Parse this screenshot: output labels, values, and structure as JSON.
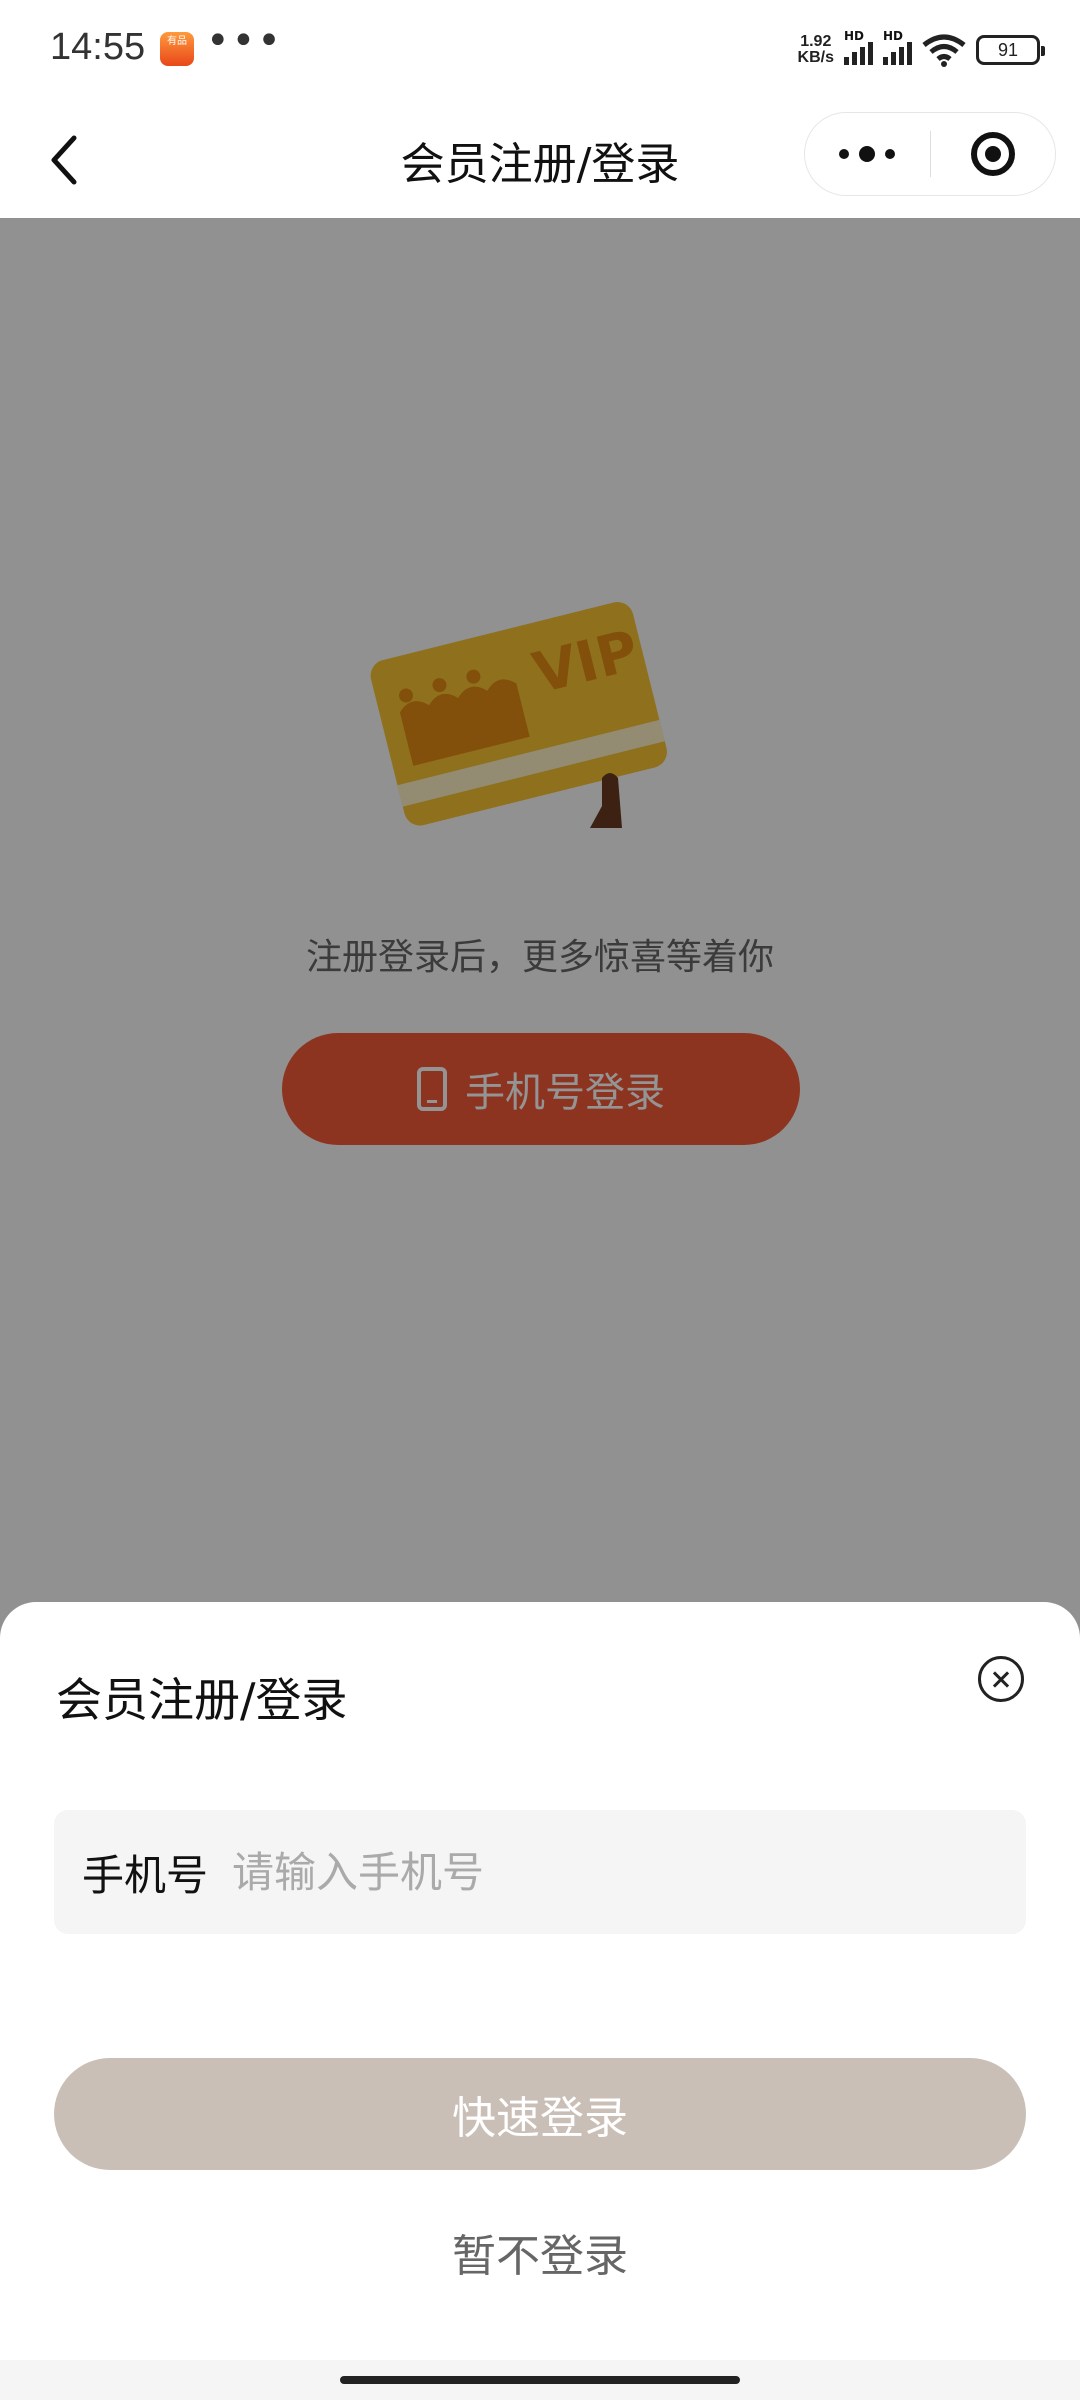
{
  "status_bar": {
    "time": "14:55",
    "app_icon_label": "有品",
    "more": "•••",
    "net_speed_value": "1.92",
    "net_speed_unit": "KB/s",
    "hd1": "HD",
    "hd2": "HD",
    "battery": "91"
  },
  "nav": {
    "title": "会员注册/登录"
  },
  "page": {
    "vip_text": "VIP",
    "promo_text": "注册登录后，更多惊喜等着你",
    "phone_login_label": "手机号登录"
  },
  "sheet": {
    "title": "会员注册/登录",
    "phone_label": "手机号",
    "phone_value": "",
    "phone_placeholder": "请输入手机号",
    "quick_login_label": "快速登录",
    "skip_label": "暂不登录"
  },
  "colors": {
    "primary": "#f35a37",
    "disabled_button": "#c9bfb7",
    "mask": "rgba(0,0,0,0.42)",
    "vip_card": "#f5c232"
  }
}
